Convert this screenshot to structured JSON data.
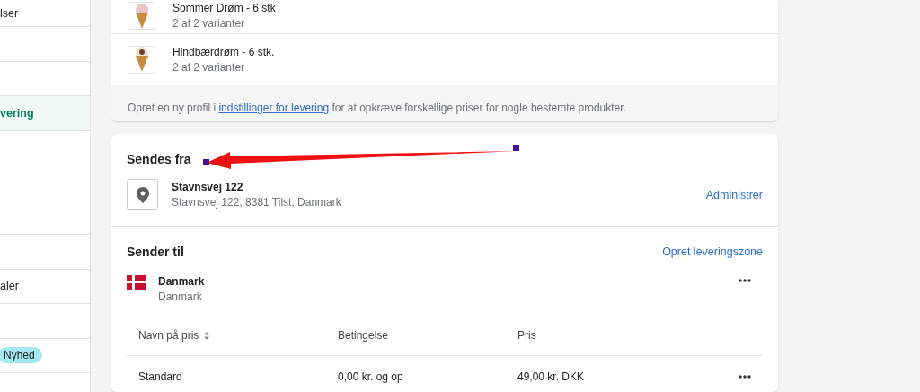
{
  "sidebar": {
    "items": [
      {
        "label": "lser",
        "selected": false
      },
      {
        "selected": false
      },
      {
        "selected": false
      },
      {
        "label": "vering",
        "selected": true
      },
      {
        "selected": false
      },
      {
        "selected": false
      },
      {
        "selected": false
      },
      {
        "selected": false
      },
      {
        "label": "aler",
        "selected": false
      },
      {
        "selected": false
      },
      {
        "badge": "Nyhed",
        "selected": false
      },
      {
        "selected": false
      }
    ]
  },
  "products": [
    {
      "name": "Sommer Drøm - 6 stk",
      "variants": "2 af 2 varianter"
    },
    {
      "name": "Hindbærdrøm - 6 stk.",
      "variants": "2 af 2 varianter"
    }
  ],
  "profile_note": {
    "before": "Opret en ny profil i",
    "link": "indstillinger for levering",
    "after": "for at opkræve forskellige priser for nogle bestemte produkter."
  },
  "ships_from": {
    "title": "Sendes fra",
    "location_name": "Stavnsvej 122",
    "address": "Stavnsvej 122, 8381 Tilst, Danmark",
    "action": "Administrer"
  },
  "ships_to": {
    "title": "Sender til",
    "action": "Opret leveringszone",
    "zones": [
      {
        "name": "Danmark",
        "countries": "Danmark",
        "table": {
          "columns": [
            "Navn på pris",
            "Betingelse",
            "Pris"
          ],
          "rows": [
            {
              "name": "Standard",
              "condition": "0,00 kr. og op",
              "price": "49,00 kr. DKK"
            }
          ]
        }
      }
    ]
  },
  "annotations": [
    {
      "kind": "arrow"
    }
  ]
}
